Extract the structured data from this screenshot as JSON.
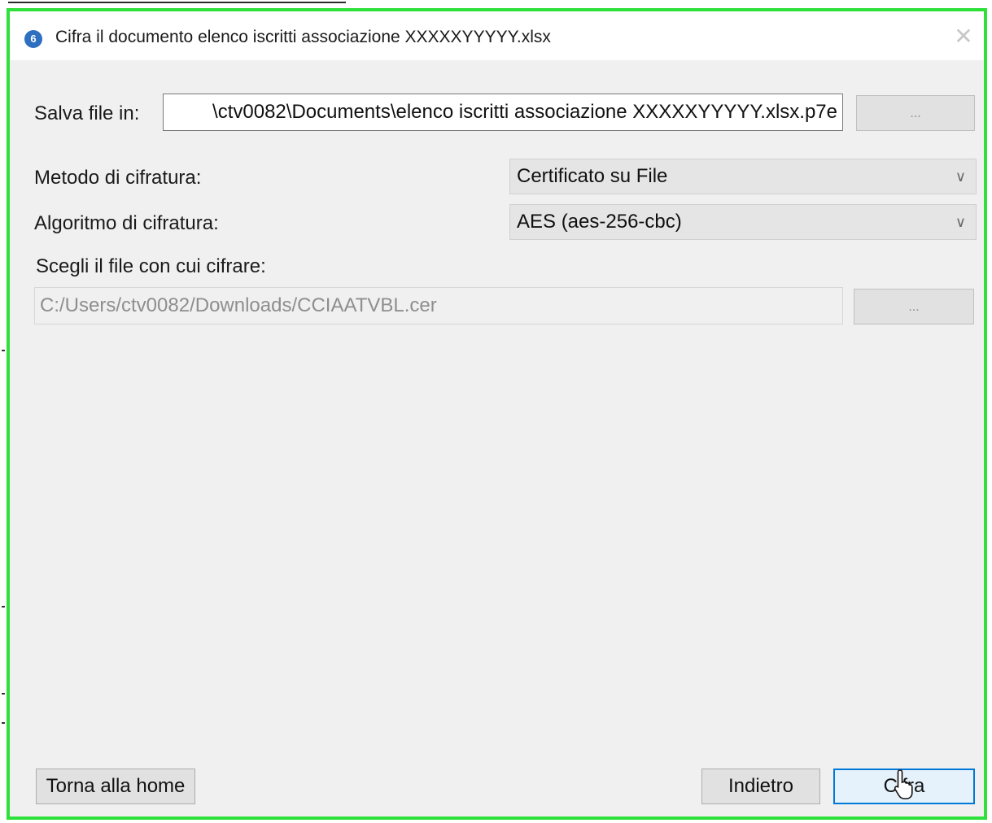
{
  "window": {
    "title": "Cifra il documento elenco iscritti associazione XXXXXYYYYY.xlsx",
    "app_icon_glyph": "6",
    "close_glyph": "✕",
    "border_color": "#2ee03a"
  },
  "save": {
    "label": "Salva file in:",
    "path": "\\ctv0082\\Documents\\elenco iscritti associazione XXXXXYYYYY.xlsx.p7e",
    "browse_label": "..."
  },
  "method": {
    "label": "Metodo di cifratura:",
    "value": "Certificato su File"
  },
  "algorithm": {
    "label": "Algoritmo di cifratura:",
    "value": "AES  (aes-256-cbc)"
  },
  "certificate": {
    "label": "Scegli il file con cui cifrare:",
    "path": "C:/Users/ctv0082/Downloads/CCIAATVBL.cer",
    "browse_label": "..."
  },
  "footer": {
    "home_label": "Torna alla home",
    "back_label": "Indietro",
    "encrypt_label": "Cifra"
  },
  "icons": {
    "chevron": "∨"
  },
  "colors": {
    "accent": "#0078d7",
    "highlight_border": "#2ee03a"
  }
}
